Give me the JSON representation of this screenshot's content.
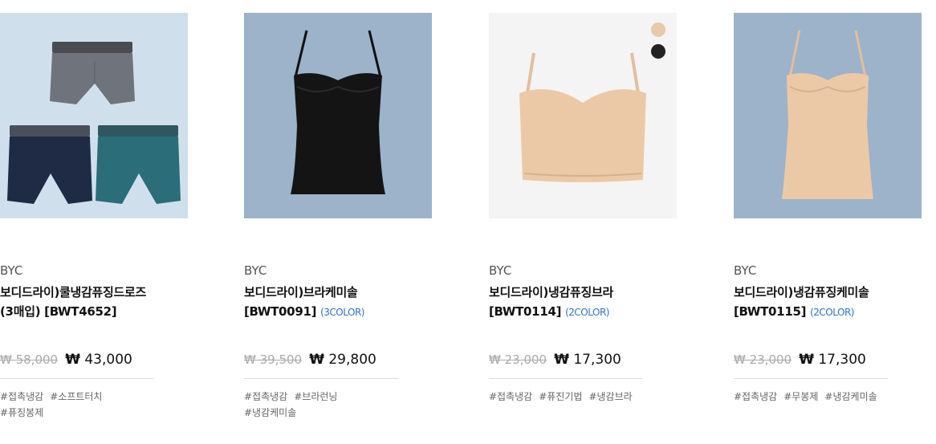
{
  "products": [
    {
      "brand": "BYC",
      "name_line1": "보디드라이)쿨냉감퓨징드로즈",
      "name_line2": "(3매입) [BWT4652]",
      "color_note": "",
      "orig_price": "₩ 58,000",
      "sale_price": "₩ 43,000",
      "tags": [
        "#접촉냉감",
        "#소프트터치",
        "#퓨징봉제"
      ],
      "bg": "#cfe0ec"
    },
    {
      "brand": "BYC",
      "name_line1": "보디드라이)브라케미솔",
      "name_line2": "[BWT0091]",
      "color_note": "(3COLOR)",
      "orig_price": "₩ 39,500",
      "sale_price": "₩ 29,800",
      "tags": [
        "#접촉냉감",
        "#브라런닝",
        "#냉감케미솔"
      ],
      "bg": "#9cb3c9"
    },
    {
      "brand": "BYC",
      "name_line1": "보디드라이)냉감퓨징브라",
      "name_line2": "[BWT0114]",
      "color_note": "(2COLOR)",
      "orig_price": "₩ 23,000",
      "sale_price": "₩ 17,300",
      "tags": [
        "#접촉냉감",
        "#퓨진기법",
        "#냉감브라"
      ],
      "bg": "#f4f4f4"
    },
    {
      "brand": "BYC",
      "name_line1": "보디드라이)냉감퓨징케미솔",
      "name_line2": "[BWT0115]",
      "color_note": "(2COLOR)",
      "orig_price": "₩ 23,000",
      "sale_price": "₩ 17,300",
      "tags": [
        "#접촉냉감",
        "#무봉제",
        "#냉감케미솔"
      ],
      "bg": "#9cb3c9"
    }
  ],
  "colors": {
    "color_link": "#2a73c9",
    "swatch_beige": "#e8c9aa",
    "swatch_black": "#222222"
  }
}
